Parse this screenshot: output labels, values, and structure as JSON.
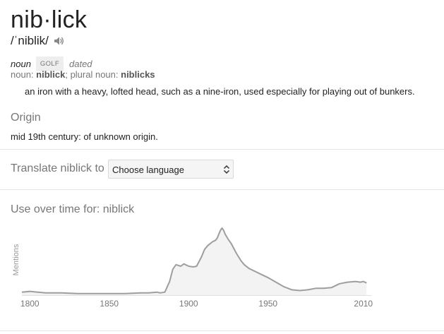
{
  "entry": {
    "headword": "nib·lick",
    "pronunciation": "/ˈniblik/",
    "part_of_speech": "noun",
    "subject_tag": "GOLF",
    "register": "dated",
    "forms_prefix": "noun: ",
    "form_singular": "niblick",
    "forms_sep": "; plural noun: ",
    "form_plural": "niblicks",
    "definition": "an iron with a heavy, lofted head, such as a nine-iron, used especially for playing out of bunkers."
  },
  "icons": {
    "speaker": "speaker-icon",
    "select_arrows": "updown-arrows-icon"
  },
  "origin": {
    "title": "Origin",
    "text": "mid 19th century: of unknown origin."
  },
  "translate": {
    "label": "Translate niblick to",
    "select_value": "Choose language"
  },
  "colors": {
    "line": "#9e9e9e",
    "fill": "#f3f3f3",
    "axis": "#e0e0e0",
    "text_muted": "#777777"
  },
  "chart_data": {
    "type": "area",
    "title": "Use over time for: niblick",
    "xlabel": "",
    "ylabel": "Mentions",
    "xlim": [
      1795,
      2015
    ],
    "ylim": [
      0,
      100
    ],
    "grid": false,
    "x_ticks": [
      1800,
      1850,
      1900,
      1950,
      2010
    ],
    "series": [
      {
        "x": [
          1795,
          1800,
          1805,
          1810,
          1820,
          1830,
          1840,
          1850,
          1860,
          1870,
          1875,
          1880,
          1882,
          1885,
          1888,
          1890,
          1892,
          1895,
          1897,
          1900,
          1903,
          1905,
          1908,
          1910,
          1912,
          1915,
          1917,
          1918,
          1919,
          1920,
          1921,
          1922,
          1923,
          1925,
          1927,
          1930,
          1933,
          1935,
          1938,
          1940,
          1945,
          1950,
          1955,
          1960,
          1965,
          1970,
          1975,
          1980,
          1985,
          1990,
          1995,
          2000,
          2005,
          2008,
          2010,
          2012
        ],
        "y": [
          4,
          5,
          4,
          3,
          3,
          2,
          2,
          2,
          2,
          3,
          3,
          4,
          3,
          4,
          18,
          34,
          40,
          38,
          41,
          38,
          37,
          38,
          50,
          60,
          65,
          70,
          72,
          75,
          80,
          85,
          88,
          85,
          80,
          73,
          67,
          55,
          45,
          40,
          35,
          33,
          28,
          23,
          17,
          11,
          7,
          6,
          7,
          9,
          9,
          10,
          15,
          17,
          18,
          17,
          18,
          16
        ]
      }
    ]
  }
}
